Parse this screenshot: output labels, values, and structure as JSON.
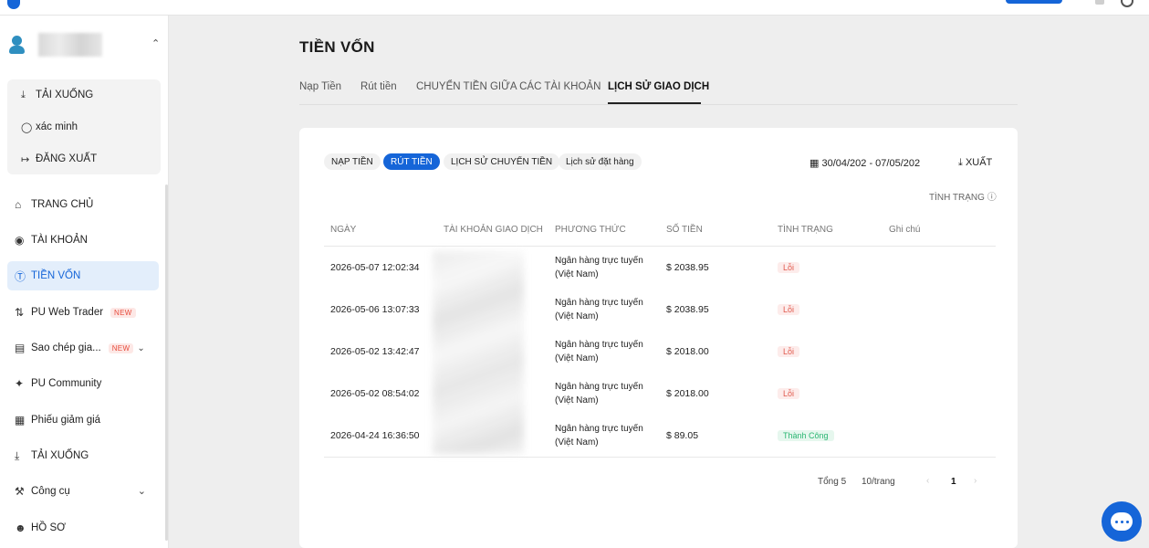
{
  "sidebar": {
    "user_menu": [
      {
        "label": "TẢI XUỐNG",
        "icon": "download-icon"
      },
      {
        "label": "xác minh",
        "icon": "shield-check-icon"
      },
      {
        "label": "ĐĂNG XUẤT",
        "icon": "logout-icon"
      }
    ],
    "nav": [
      {
        "label": "TRANG CHỦ",
        "icon": "home-icon"
      },
      {
        "label": "TÀI KHOẢN",
        "icon": "account-icon"
      },
      {
        "label": "TIỀN VỐN",
        "icon": "dollar-circle-icon",
        "active": true
      },
      {
        "label": "PU Web Trader",
        "icon": "chart-icon",
        "badge": "NEW"
      },
      {
        "label": "Sao chép gia...",
        "icon": "copy-trade-icon",
        "badge": "NEW"
      },
      {
        "label": "PU Community",
        "icon": "community-icon"
      },
      {
        "label": "Phiếu giảm giá",
        "icon": "coupon-icon"
      },
      {
        "label": "TẢI XUỐNG",
        "icon": "download-icon"
      },
      {
        "label": "Công cụ",
        "icon": "wrench-icon"
      },
      {
        "label": "HỒ SƠ",
        "icon": "profile-icon"
      }
    ],
    "new_badge": "NEW"
  },
  "main": {
    "title": "TIỀN VỐN",
    "tabs": [
      {
        "label": "Nạp Tiền"
      },
      {
        "label": "Rút tiền"
      },
      {
        "label": "CHUYỂN TIỀN GIỮA CÁC TÀI KHOẢN"
      },
      {
        "label": "LỊCH SỬ GIAO DỊCH",
        "active": true
      }
    ],
    "filters": [
      {
        "label": "NẠP TIỀN"
      },
      {
        "label": "RÚT TIỀN",
        "active": true
      },
      {
        "label": "LỊCH SỬ CHUYỂN TIỀN"
      },
      {
        "label": "Lịch sử đặt hàng"
      }
    ],
    "date_range": "30/04/202 - 07/05/202",
    "export_label": "XUẤT",
    "status_filter": "TÌNH TRẠNG",
    "columns": [
      "NGÀY",
      "TÀI KHOẢN GIAO DỊCH",
      "PHƯƠNG THỨC",
      "SỐ TIỀN",
      "TÌNH TRẠNG",
      "Ghi chú"
    ],
    "rows": [
      {
        "date": "2026-05-07 12:02:34",
        "method_line1": "Ngân hàng trực tuyến",
        "method_line2": "(Việt Nam)",
        "amount": "$ 2038.95",
        "status": "Lỗi",
        "status_type": "error"
      },
      {
        "date": "2026-05-06 13:07:33",
        "method_line1": "Ngân hàng trực tuyến",
        "method_line2": "(Việt Nam)",
        "amount": "$ 2038.95",
        "status": "Lỗi",
        "status_type": "error"
      },
      {
        "date": "2026-05-02 13:42:47",
        "method_line1": "Ngân hàng trực tuyến",
        "method_line2": "(Việt Nam)",
        "amount": "$ 2018.00",
        "status": "Lỗi",
        "status_type": "error"
      },
      {
        "date": "2026-05-02 08:54:02",
        "method_line1": "Ngân hàng trực tuyến",
        "method_line2": "(Việt Nam)",
        "amount": "$ 2018.00",
        "status": "Lỗi",
        "status_type": "error"
      },
      {
        "date": "2026-04-24 16:36:50",
        "method_line1": "Ngân hàng trực tuyến",
        "method_line2": "(Việt Nam)",
        "amount": "$ 89.05",
        "status": "Thành Công",
        "status_type": "success"
      }
    ],
    "pager": {
      "total": "Tổng 5",
      "page_size": "10/trang",
      "current_page": "1",
      "prev": "‹",
      "next": "›"
    }
  },
  "colors": {
    "accent": "#1565d8",
    "error": "#e05a4e",
    "success": "#2bb673"
  }
}
